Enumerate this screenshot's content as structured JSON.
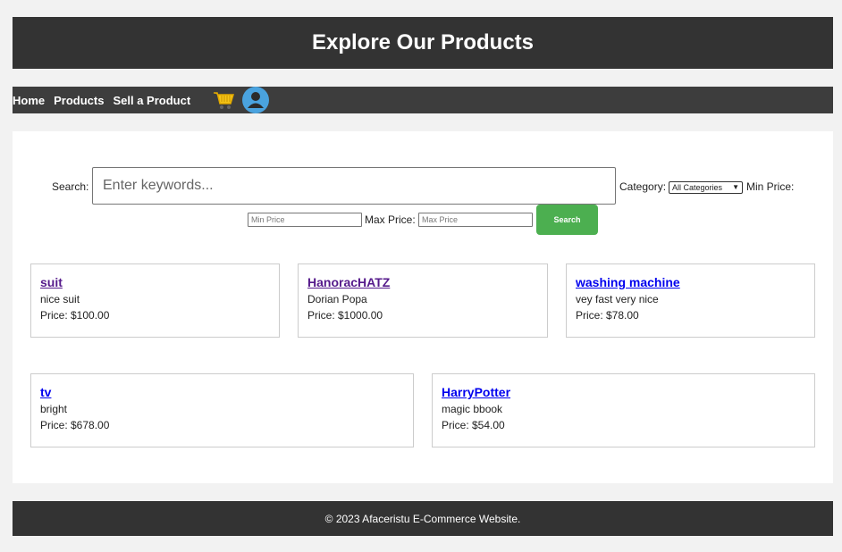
{
  "header": {
    "title": "Explore Our Products"
  },
  "nav": {
    "items": [
      {
        "label": "Home"
      },
      {
        "label": "Products"
      },
      {
        "label": "Sell a Product"
      }
    ],
    "cart_icon": "shopping-cart-icon",
    "user_icon": "user-avatar-icon"
  },
  "search": {
    "label": "Search:",
    "placeholder": "Enter keywords...",
    "category_label": "Category:",
    "category_selected": "All Categories",
    "min_price_label": "Min Price:",
    "min_price_placeholder": "Min Price",
    "max_price_label": "Max Price:",
    "max_price_placeholder": "Max Price",
    "button_label": "Search",
    "button_color": "#4caf50"
  },
  "products": [
    {
      "name": "suit",
      "description": "nice suit",
      "price": "Price: $100.00"
    },
    {
      "name": "HanoracHATZ",
      "description": "Dorian Popa",
      "price": "Price: $1000.00"
    },
    {
      "name": "washing machine",
      "description": "vey fast very nice",
      "price": "Price: $78.00"
    },
    {
      "name": "tv",
      "description": "bright",
      "price": "Price: $678.00"
    },
    {
      "name": "HarryPotter",
      "description": "magic bbook",
      "price": "Price: $54.00"
    }
  ],
  "footer": {
    "text": "© 2023 Afaceristu E-Commerce Website."
  },
  "colors": {
    "header_bg": "#333333",
    "nav_bg": "#3d3d3d",
    "visited_link": "#551a8b",
    "link": "#0000ee"
  }
}
